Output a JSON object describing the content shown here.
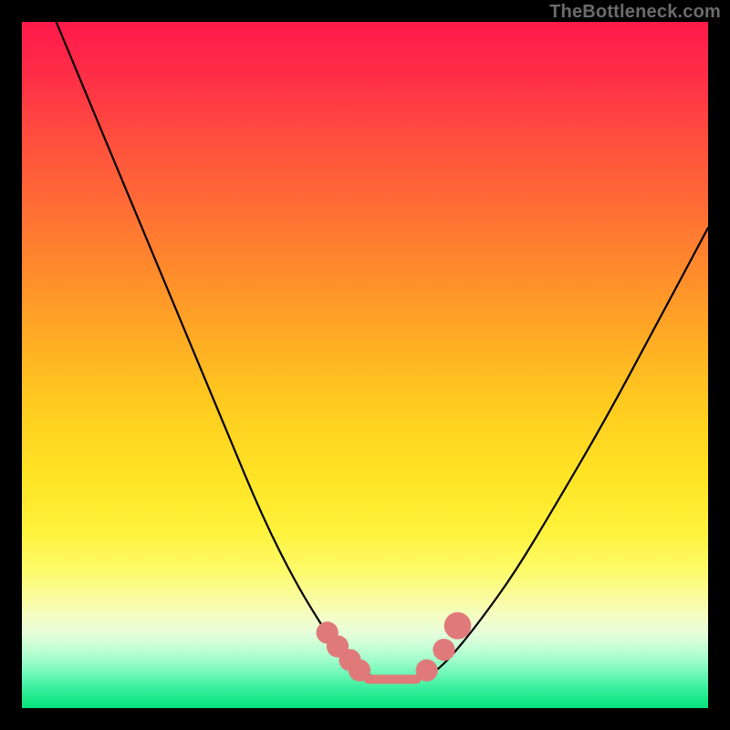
{
  "watermark": "TheBottleneck.com",
  "chart_data": {
    "type": "line",
    "title": "",
    "xlabel": "",
    "ylabel": "",
    "xlim": [
      0,
      100
    ],
    "ylim": [
      0,
      100
    ],
    "grid": false,
    "legend": false,
    "background_gradient": {
      "stops": [
        {
          "pos": 0,
          "color": "#ff1a4b"
        },
        {
          "pos": 50,
          "color": "#ffcc1f"
        },
        {
          "pos": 85,
          "color": "#f9fca0"
        },
        {
          "pos": 100,
          "color": "#08df78"
        }
      ]
    },
    "series": [
      {
        "name": "bottleneck-curve",
        "x": [
          5,
          10,
          15,
          20,
          25,
          30,
          35,
          40,
          45,
          47,
          50,
          53,
          55,
          57,
          60,
          63,
          67,
          72,
          78,
          85,
          92,
          100
        ],
        "y": [
          100,
          88,
          76,
          64,
          52,
          40,
          28,
          18,
          10,
          7,
          5,
          4,
          4,
          4,
          5,
          8,
          13,
          20,
          30,
          42,
          55,
          70
        ]
      }
    ],
    "markers": [
      {
        "x": 44.5,
        "y": 11,
        "r": 1.2
      },
      {
        "x": 46.0,
        "y": 9,
        "r": 1.2
      },
      {
        "x": 47.8,
        "y": 7,
        "r": 1.2
      },
      {
        "x": 49.2,
        "y": 5.5,
        "r": 1.2
      },
      {
        "x": 59.0,
        "y": 5.5,
        "r": 1.2
      },
      {
        "x": 61.5,
        "y": 8.5,
        "r": 1.2
      },
      {
        "x": 63.5,
        "y": 12,
        "r": 1.6
      }
    ],
    "flat_segment": {
      "x0": 50.5,
      "x1": 57.5,
      "y": 4.2
    },
    "colors": {
      "curve": "#000000",
      "markers": "#e07a7a"
    }
  }
}
